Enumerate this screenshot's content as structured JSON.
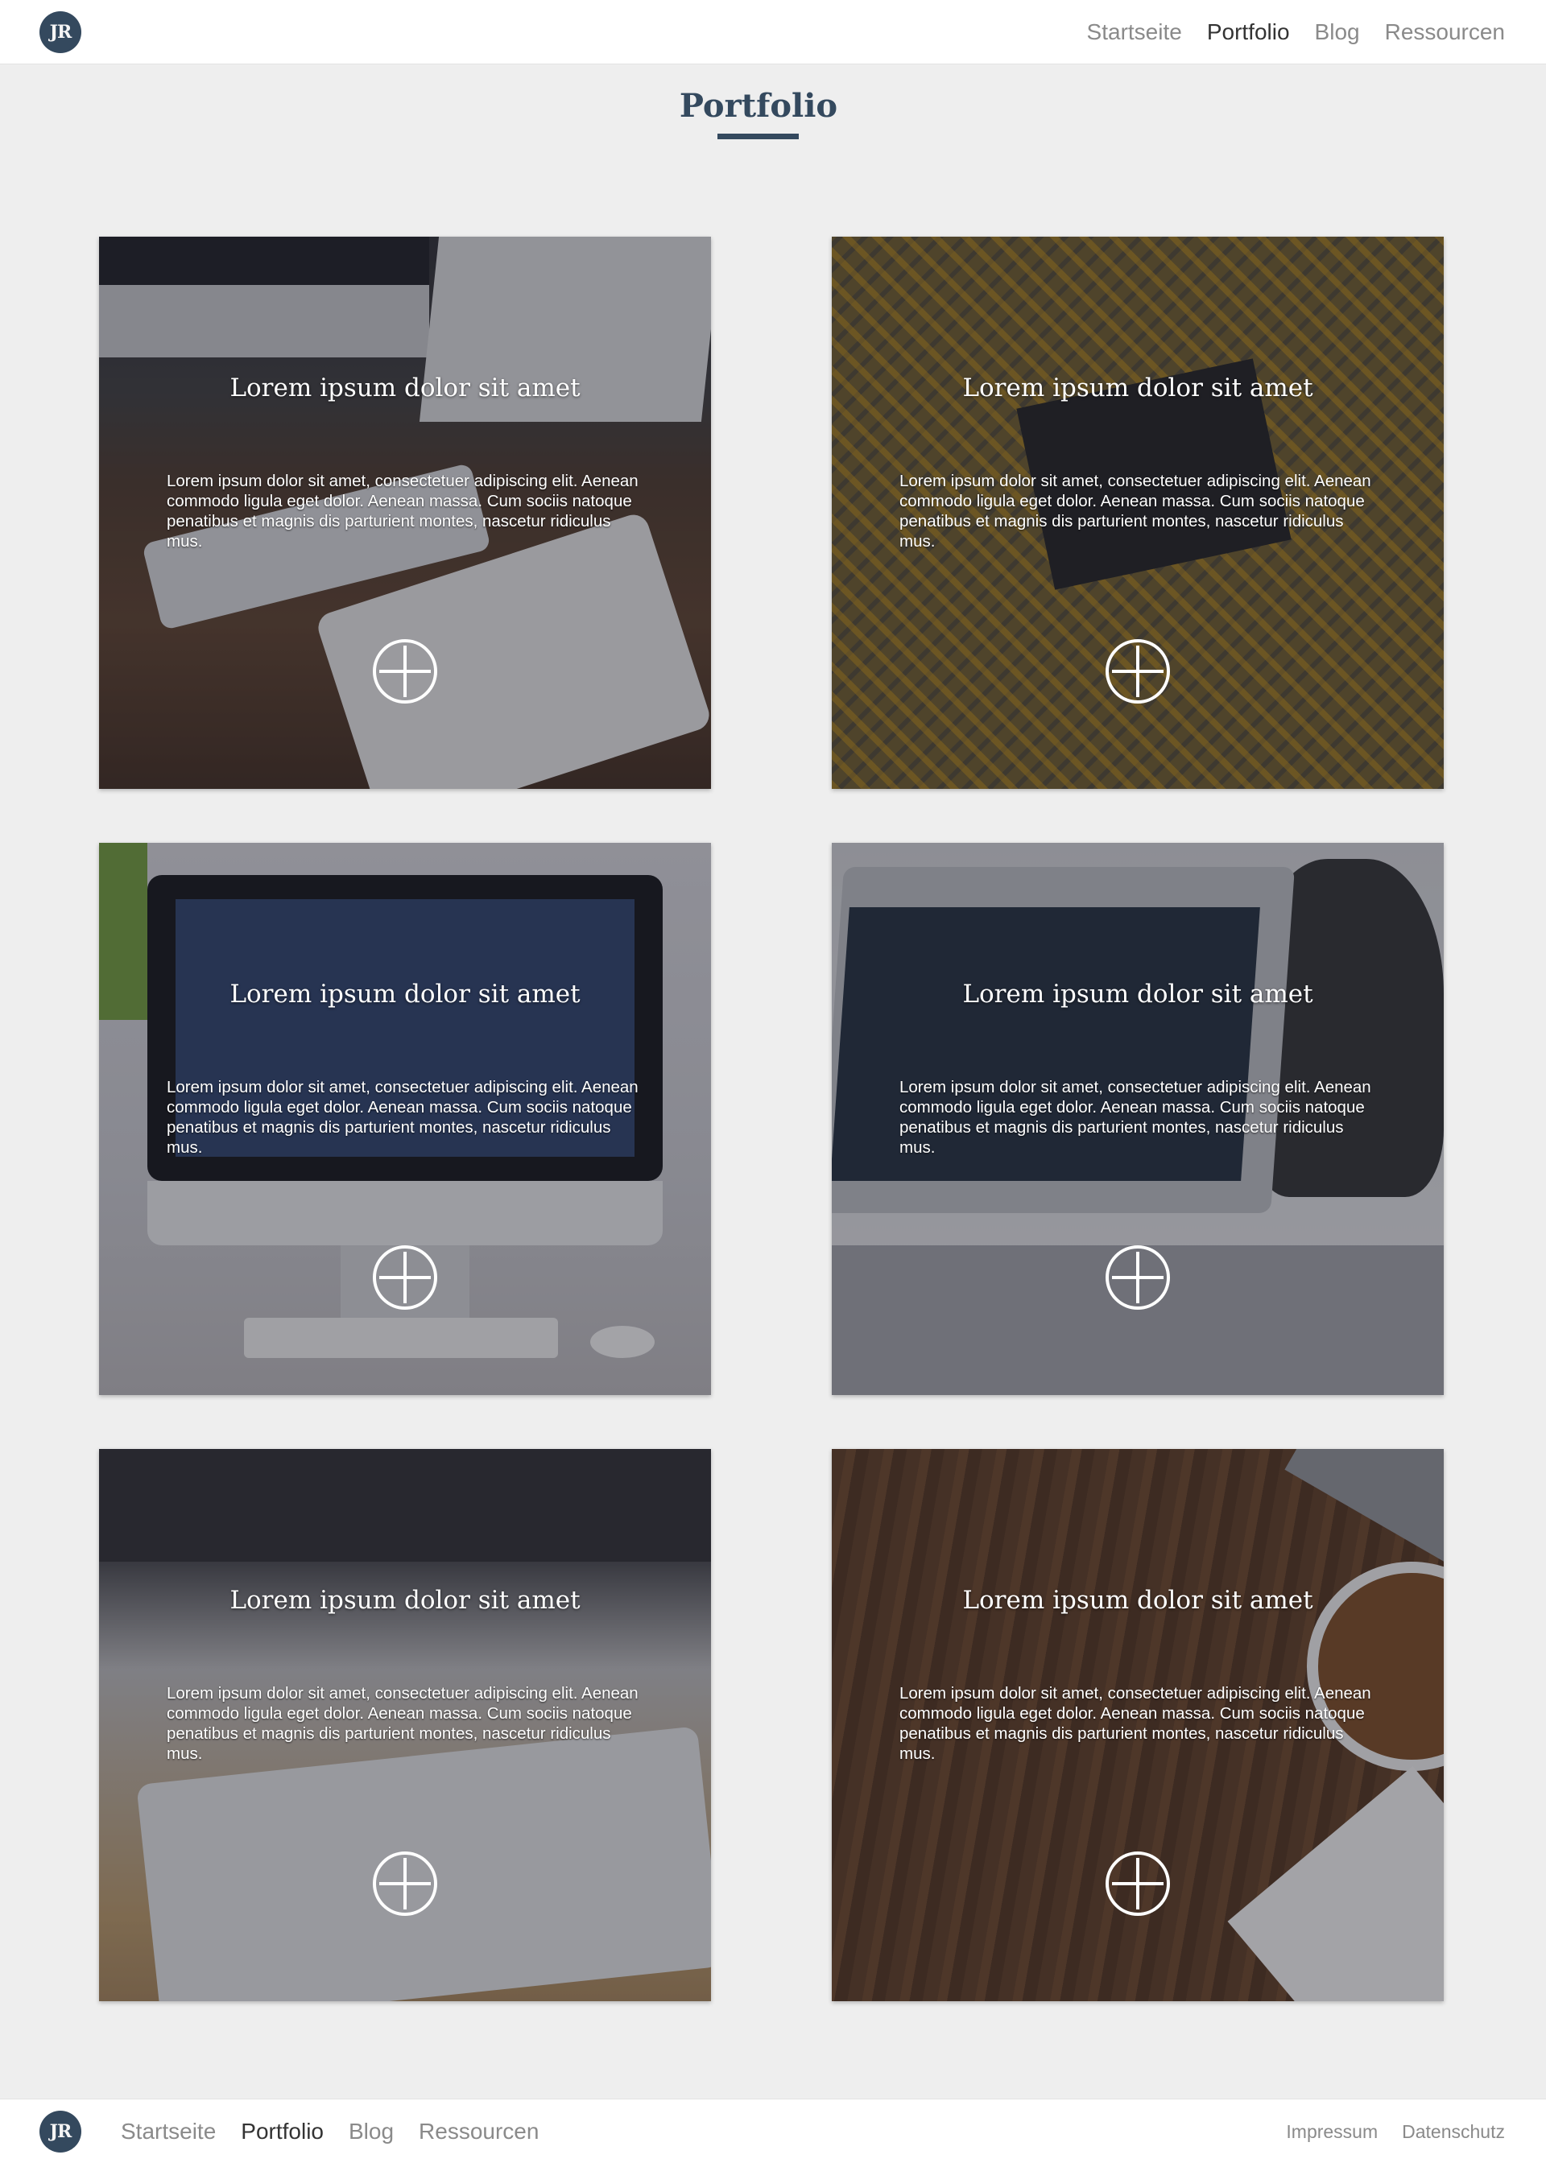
{
  "header": {
    "logo_text": "JR",
    "nav": [
      "Startseite",
      "Portfolio",
      "Blog",
      "Ressourcen"
    ],
    "active": "Portfolio"
  },
  "page": {
    "title": "Portfolio"
  },
  "cards": [
    {
      "title": "Lorem ipsum dolor sit amet",
      "text": "Lorem ipsum dolor sit amet, consectetuer adipiscing elit. Aenean commodo ligula eget dolor. Aenean massa. Cum sociis natoque penatibus et magnis dis parturient montes, nascetur ridiculus mus."
    },
    {
      "title": "Lorem ipsum dolor sit amet",
      "text": "Lorem ipsum dolor sit amet, consectetuer adipiscing elit. Aenean commodo ligula eget dolor. Aenean massa. Cum sociis natoque penatibus et magnis dis parturient montes, nascetur ridiculus mus."
    },
    {
      "title": "Lorem ipsum dolor sit amet",
      "text": "Lorem ipsum dolor sit amet, consectetuer adipiscing elit. Aenean commodo ligula eget dolor. Aenean massa. Cum sociis natoque penatibus et magnis dis parturient montes, nascetur ridiculus mus."
    },
    {
      "title": "Lorem ipsum dolor sit amet",
      "text": "Lorem ipsum dolor sit amet, consectetuer adipiscing elit. Aenean commodo ligula eget dolor. Aenean massa. Cum sociis natoque penatibus et magnis dis parturient montes, nascetur ridiculus mus."
    },
    {
      "title": "Lorem ipsum dolor sit amet",
      "text": "Lorem ipsum dolor sit amet, consectetuer adipiscing elit. Aenean commodo ligula eget dolor. Aenean massa. Cum sociis natoque penatibus et magnis dis parturient montes, nascetur ridiculus mus."
    },
    {
      "title": "Lorem ipsum dolor sit amet",
      "text": "Lorem ipsum dolor sit amet, consectetuer adipiscing elit. Aenean commodo ligula eget dolor. Aenean massa. Cum sociis natoque penatibus et magnis dis parturient montes, nascetur ridiculus mus."
    }
  ],
  "card_icons": "plus-circle-icon",
  "footer": {
    "logo_text": "JR",
    "nav": [
      "Startseite",
      "Portfolio",
      "Blog",
      "Ressourcen"
    ],
    "active": "Portfolio",
    "legal": [
      "Impressum",
      "Datenschutz"
    ]
  },
  "colors": {
    "brand": "#34495e",
    "nav_inactive": "#8a8a8a",
    "nav_active": "#333333",
    "page_background": "#eeeeee"
  }
}
